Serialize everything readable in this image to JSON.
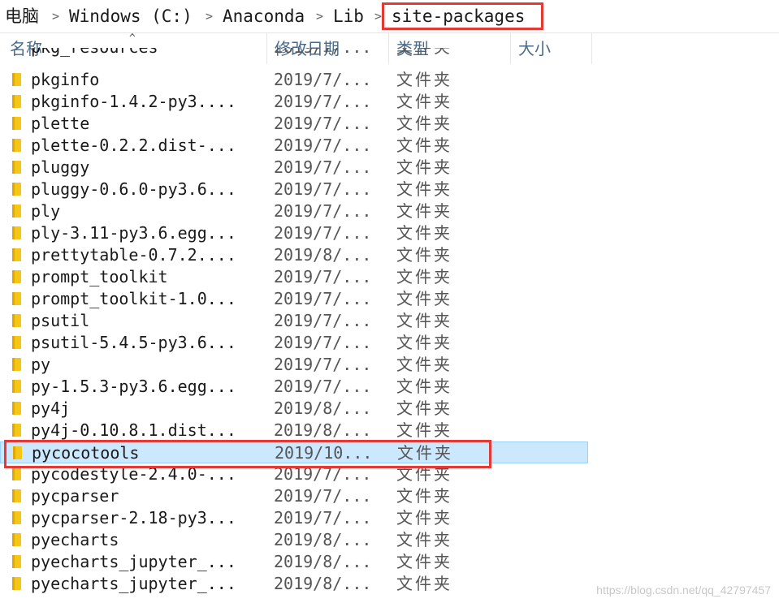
{
  "breadcrumb": {
    "items": [
      "电脑",
      "Windows (C:)",
      "Anaconda",
      "Lib",
      "site-packages"
    ],
    "separator": ">"
  },
  "columns": {
    "name": "名称",
    "date": "修改日期",
    "type": "类型",
    "size": "大小"
  },
  "partial_top_row": {
    "name": "pkg_resources",
    "date": "2019/7/...",
    "type": "文件夹"
  },
  "rows": [
    {
      "name": "pkginfo",
      "date": "2019/7/...",
      "type": "文件夹"
    },
    {
      "name": "pkginfo-1.4.2-py3....",
      "date": "2019/7/...",
      "type": "文件夹"
    },
    {
      "name": "plette",
      "date": "2019/7/...",
      "type": "文件夹"
    },
    {
      "name": "plette-0.2.2.dist-...",
      "date": "2019/7/...",
      "type": "文件夹"
    },
    {
      "name": "pluggy",
      "date": "2019/7/...",
      "type": "文件夹"
    },
    {
      "name": "pluggy-0.6.0-py3.6...",
      "date": "2019/7/...",
      "type": "文件夹"
    },
    {
      "name": "ply",
      "date": "2019/7/...",
      "type": "文件夹"
    },
    {
      "name": "ply-3.11-py3.6.egg...",
      "date": "2019/7/...",
      "type": "文件夹"
    },
    {
      "name": "prettytable-0.7.2....",
      "date": "2019/8/...",
      "type": "文件夹"
    },
    {
      "name": "prompt_toolkit",
      "date": "2019/7/...",
      "type": "文件夹"
    },
    {
      "name": "prompt_toolkit-1.0...",
      "date": "2019/7/...",
      "type": "文件夹"
    },
    {
      "name": "psutil",
      "date": "2019/7/...",
      "type": "文件夹"
    },
    {
      "name": "psutil-5.4.5-py3.6...",
      "date": "2019/7/...",
      "type": "文件夹"
    },
    {
      "name": "py",
      "date": "2019/7/...",
      "type": "文件夹"
    },
    {
      "name": "py-1.5.3-py3.6.egg...",
      "date": "2019/7/...",
      "type": "文件夹"
    },
    {
      "name": "py4j",
      "date": "2019/8/...",
      "type": "文件夹"
    },
    {
      "name": "py4j-0.10.8.1.dist...",
      "date": "2019/8/...",
      "type": "文件夹"
    },
    {
      "name": "pycocotools",
      "date": "2019/10...",
      "type": "文件夹",
      "selected": true
    },
    {
      "name": "pycodestyle-2.4.0-...",
      "date": "2019/7/...",
      "type": "文件夹"
    },
    {
      "name": "pycparser",
      "date": "2019/7/...",
      "type": "文件夹"
    },
    {
      "name": "pycparser-2.18-py3...",
      "date": "2019/7/...",
      "type": "文件夹"
    },
    {
      "name": "pyecharts",
      "date": "2019/8/...",
      "type": "文件夹"
    },
    {
      "name": "pyecharts_jupyter_...",
      "date": "2019/8/...",
      "type": "文件夹"
    },
    {
      "name": "pyecharts_jupyter_...",
      "date": "2019/8/...",
      "type": "文件夹"
    }
  ],
  "colors": {
    "selection_bg": "#cce8ff",
    "selection_border": "#99d1ff",
    "highlight_box": "#e53935",
    "folder_yellow": "#f5c518",
    "header_text": "#4a6a8a"
  },
  "icons": {
    "folder": "folder-icon",
    "separator": "chevron-right-icon",
    "sort": "sort-up-caret-icon"
  },
  "watermark": "https://blog.csdn.net/qq_42797457"
}
